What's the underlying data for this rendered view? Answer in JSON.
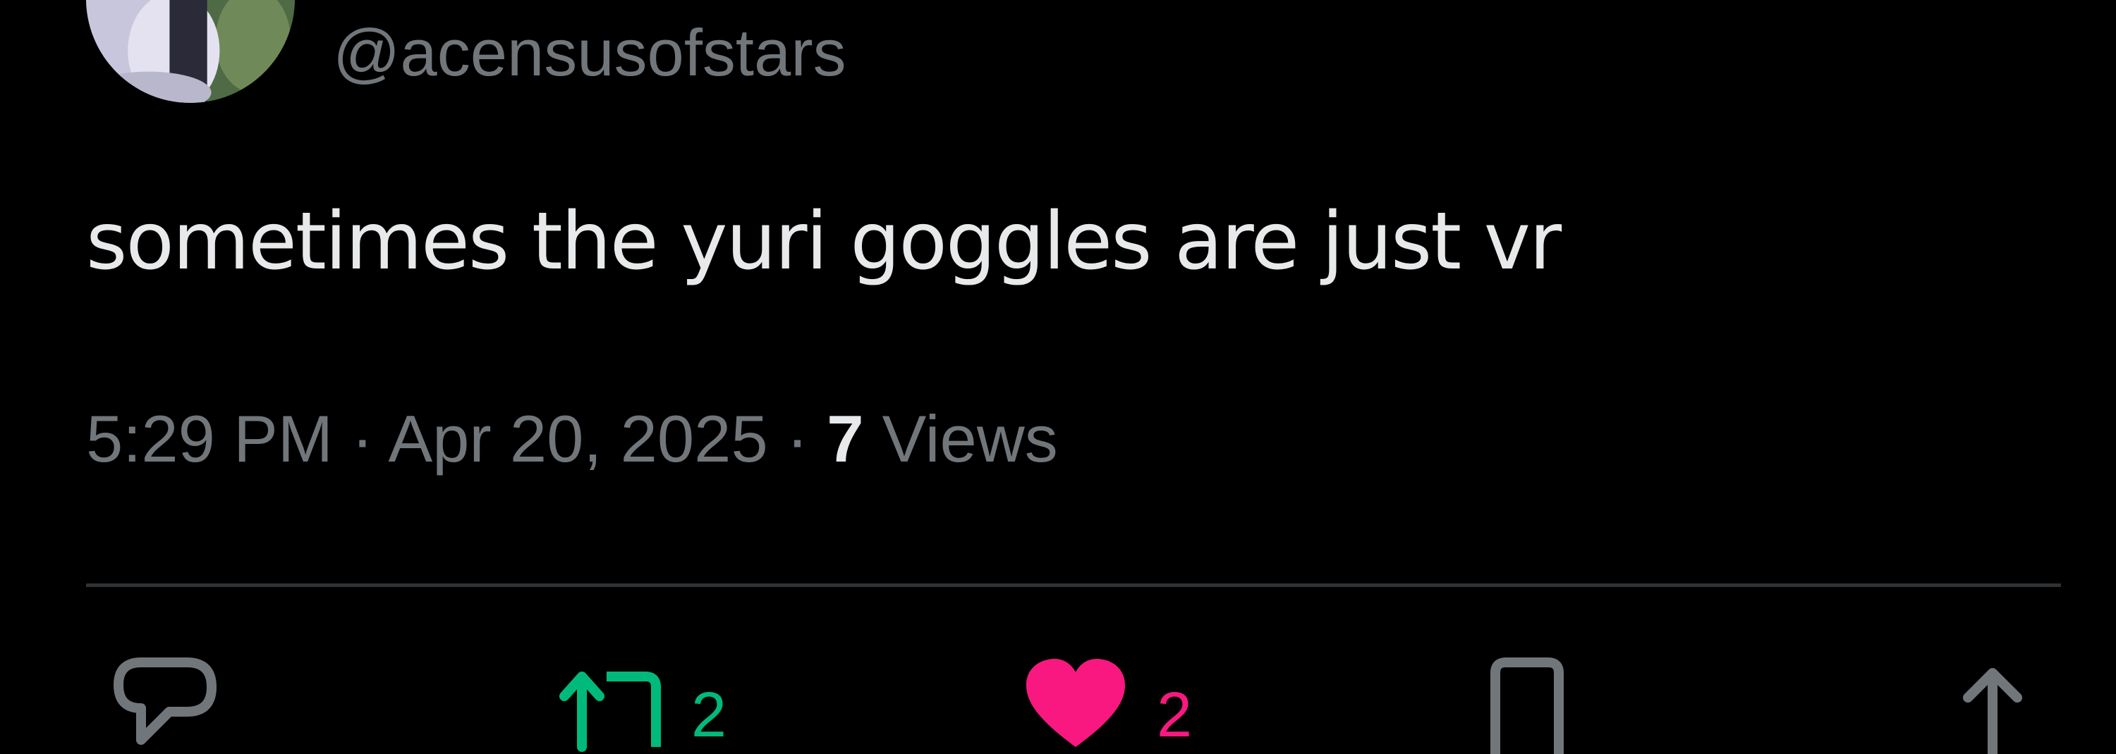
{
  "tweet": {
    "handle": "@acensusofstars",
    "text": "sometimes the yuri goggles are just vr",
    "time": "5:29 PM",
    "separator": " · ",
    "date": "Apr 20, 2025",
    "views_count": "7",
    "views_label": " Views"
  },
  "actions": {
    "reply": {
      "icon": "reply-icon",
      "count": ""
    },
    "repost": {
      "icon": "repost-icon",
      "count": "2",
      "color": "#00ba7c"
    },
    "like": {
      "icon": "heart-icon",
      "count": "2",
      "color": "#f91880"
    },
    "bookmark": {
      "icon": "bookmark-icon",
      "count": ""
    },
    "share": {
      "icon": "share-icon",
      "count": ""
    }
  },
  "colors": {
    "background": "#000000",
    "primary_text": "#e7e9ea",
    "secondary_text": "#71767b",
    "divider": "#2f3336"
  }
}
